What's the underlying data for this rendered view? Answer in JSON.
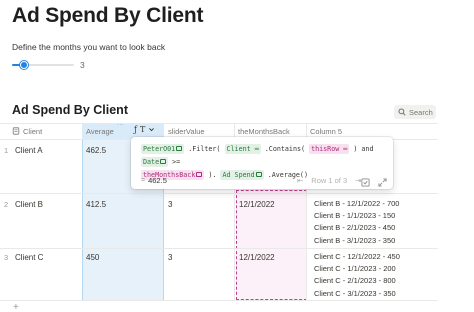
{
  "page": {
    "title": "Ad Spend By Client",
    "slider_label": "Define the months you want to look back",
    "slider_value": "3",
    "slider_fraction": 0.2
  },
  "database": {
    "title": "Ad Spend By Client",
    "search_label": "Search",
    "columns": [
      "Client",
      "Average",
      "sliderValue",
      "theMonthsBack",
      "Column 5"
    ]
  },
  "rows": [
    {
      "num": "1",
      "client": "Client A",
      "average": "462.5",
      "slider": "",
      "months_back": "",
      "column5": []
    },
    {
      "num": "2",
      "client": "Client B",
      "average": "412.5",
      "slider": "3",
      "months_back": "12/1/2022",
      "column5": [
        "Client B - 12/1/2022 - 700",
        "Client B - 1/1/2023 - 150",
        "Client B - 2/1/2023 - 450",
        "Client B - 3/1/2023 - 350"
      ]
    },
    {
      "num": "3",
      "client": "Client C",
      "average": "450",
      "slider": "3",
      "months_back": "12/1/2022",
      "column5": [
        "Client C - 12/1/2022 - 450",
        "Client C - 1/1/2023 - 200",
        "Client C - 2/1/2023 - 800",
        "Client C - 3/1/2023 - 350"
      ]
    }
  ],
  "formula_popup": {
    "tokens": {
      "db_chip": "PeterO01",
      "filter": ".Filter(",
      "client_chip": "Client",
      "contains": ".Contains(",
      "thisrow_chip": "thisRow",
      "and": ") and",
      "date_chip": "Date",
      "gte": ">=",
      "monthsback_chip": "theMonthsBack",
      "close": ").",
      "adspend_chip": "Ad Spend",
      "average": ".Average()"
    },
    "result_prefix": "=",
    "result": "462.5",
    "row_nav": "Row 1 of 3"
  },
  "add_row_label": "+"
}
